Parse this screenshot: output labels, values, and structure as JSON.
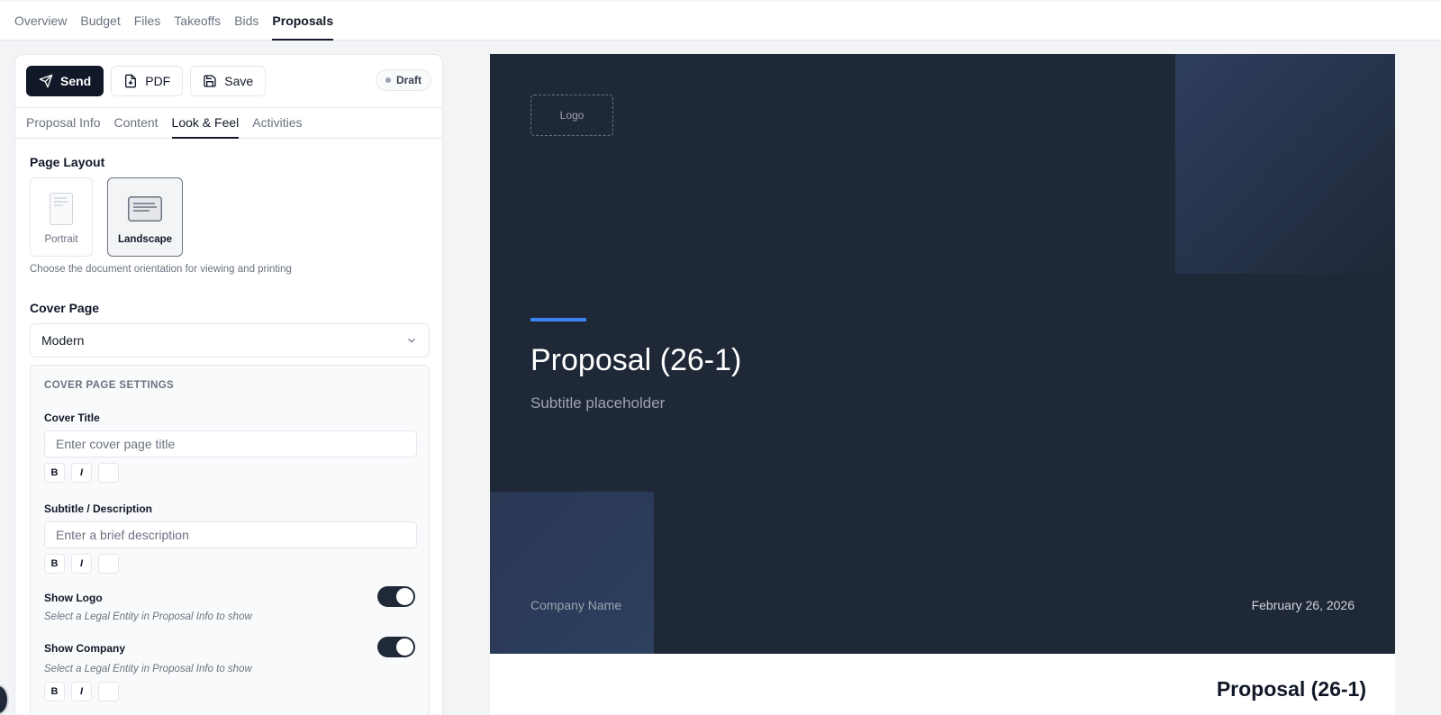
{
  "nav": {
    "tabs": [
      "Overview",
      "Budget",
      "Files",
      "Takeoffs",
      "Bids",
      "Proposals"
    ],
    "active": "Proposals"
  },
  "toolbar": {
    "send_label": "Send",
    "pdf_label": "PDF",
    "save_label": "Save",
    "status": "Draft"
  },
  "subtabs": {
    "items": [
      "Proposal Info",
      "Content",
      "Look & Feel",
      "Activities"
    ],
    "active": "Look & Feel"
  },
  "page_layout": {
    "title": "Page Layout",
    "options": [
      "Portrait",
      "Landscape"
    ],
    "selected": "Landscape",
    "hint": "Choose the document orientation for viewing and printing"
  },
  "cover_page": {
    "title": "Cover Page",
    "selected": "Modern",
    "settings_caption": "COVER PAGE SETTINGS",
    "cover_title_label": "Cover Title",
    "cover_title_placeholder": "Enter cover page title",
    "subtitle_label": "Subtitle / Description",
    "subtitle_placeholder": "Enter a brief description",
    "show_logo_label": "Show Logo",
    "show_logo_on": true,
    "show_logo_note": "Select a Legal Entity in Proposal Info to show",
    "show_company_label": "Show Company",
    "show_company_on": true,
    "show_company_note": "Select a Legal Entity in Proposal Info to show",
    "bold": "B",
    "italic": "I"
  },
  "preview": {
    "logo_text": "Logo",
    "title": "Proposal (26-1)",
    "subtitle": "Subtitle placeholder",
    "company": "Company Name",
    "date": "February 26, 2026",
    "page2_title": "Proposal (26-1)",
    "accent_color": "#3b82f6",
    "cover_bg": "#1f2837"
  }
}
